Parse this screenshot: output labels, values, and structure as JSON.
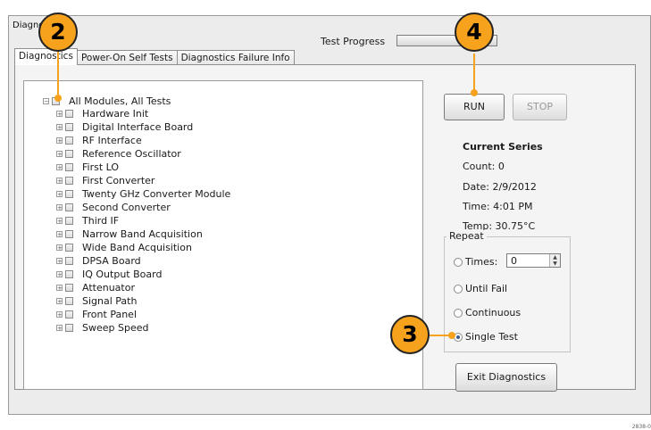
{
  "window": {
    "title": "Diagnostics"
  },
  "progress": {
    "label": "Test Progress",
    "value": 0
  },
  "tabs": [
    {
      "label": "Diagnostics"
    },
    {
      "label": "Power-On Self Tests"
    },
    {
      "label": "Diagnostics Failure Info"
    }
  ],
  "tree": {
    "root": "All Modules, All Tests",
    "items": [
      "Hardware Init",
      "Digital Interface Board",
      "RF Interface",
      "Reference Oscillator",
      "First LO",
      "First Converter",
      "Twenty GHz Converter Module",
      "Second Converter",
      "Third IF",
      "Narrow Band Acquisition",
      "Wide Band Acquisition",
      "DPSA Board",
      "IQ Output Board",
      "Attenuator",
      "Signal Path",
      "Front Panel",
      "Sweep Speed"
    ]
  },
  "buttons": {
    "run": "RUN",
    "stop": "STOP",
    "exit": "Exit Diagnostics"
  },
  "series": {
    "title": "Current Series",
    "count": "Count:  0",
    "date": "Date:  2/9/2012",
    "time": "Time:  4:01 PM",
    "temp": "Temp:  30.75°C"
  },
  "repeat": {
    "title": "Repeat",
    "times_label": "Times:",
    "times_value": "0",
    "until_fail": "Until Fail",
    "continuous": "Continuous",
    "single_test": "Single Test",
    "selected": "single_test"
  },
  "callouts": {
    "c2": "2",
    "c3": "3",
    "c4": "4"
  },
  "corner": "2838-0",
  "colors": {
    "callout": "#f7a21c",
    "window_bg": "#ececec"
  }
}
